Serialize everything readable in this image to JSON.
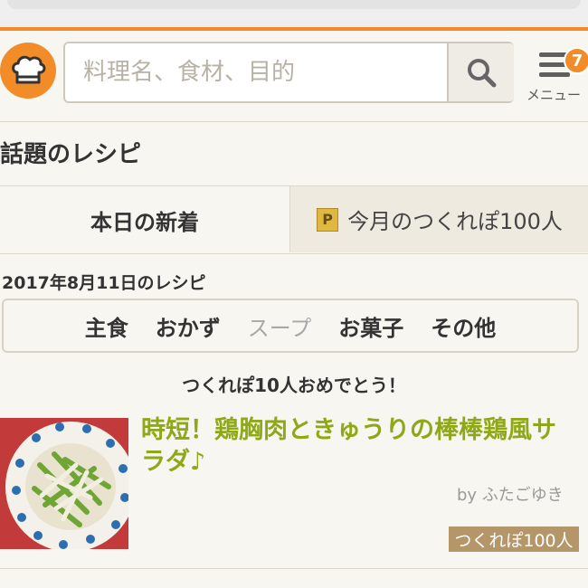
{
  "header": {
    "search": {
      "placeholder": "料理名、食材、目的"
    },
    "menu": {
      "label": "メニュー",
      "badge_count": "7"
    }
  },
  "section_title": "話題のレシピ",
  "tabs": [
    {
      "label": "本日の新着",
      "active": true
    },
    {
      "label": "今月のつくれぽ100人",
      "icon": "p-icon",
      "active": false
    }
  ],
  "date_label": "2017年8月11日のレシピ",
  "categories": [
    {
      "label": "主食",
      "active": true
    },
    {
      "label": "おかず",
      "active": true
    },
    {
      "label": "スープ",
      "active": false
    },
    {
      "label": "お菓子",
      "active": true
    },
    {
      "label": "その他",
      "active": true
    }
  ],
  "congrats": "つくれぽ10人おめでとう！",
  "recipe": {
    "title": "時短！鶏胸肉ときゅうりの棒棒鶏風サラダ♪",
    "author": "by ふたごゆき",
    "badge": "つくれぽ100人"
  },
  "colors": {
    "accent": "#f28c28",
    "recipe_title": "#8ea818",
    "badge_bg": "#b59668"
  }
}
